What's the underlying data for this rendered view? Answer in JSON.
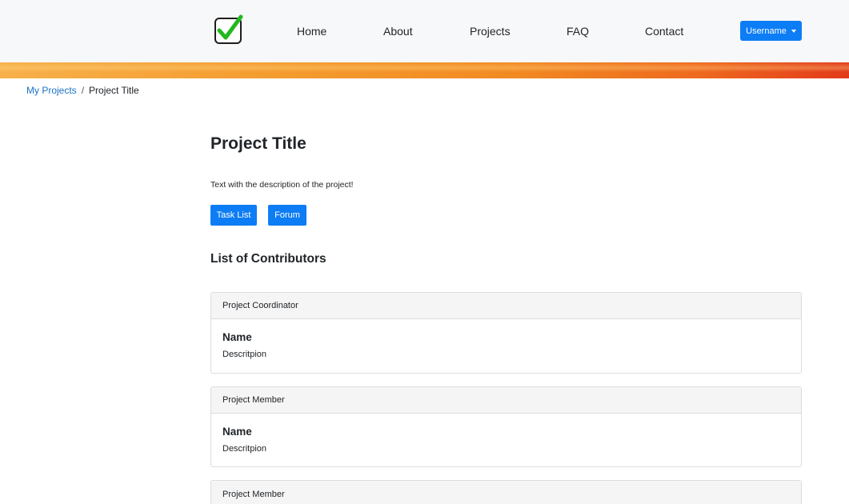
{
  "navbar": {
    "items": [
      {
        "label": "Home"
      },
      {
        "label": "About"
      },
      {
        "label": "Projects"
      },
      {
        "label": "FAQ"
      },
      {
        "label": "Contact"
      }
    ],
    "user_button": "Username",
    "accent_color": "#0d7df5"
  },
  "breadcrumb": {
    "link": "My Projects",
    "separator": "/",
    "current": "Project Title"
  },
  "project": {
    "title": "Project Title",
    "description": "Text with the description of the project!",
    "buttons": {
      "task_list": "Task List",
      "forum": "Forum"
    }
  },
  "contributors": {
    "heading": "List of Contributors",
    "cards": [
      {
        "role": "Project Coordinator",
        "name": "Name",
        "description": "Descritpion"
      },
      {
        "role": "Project Member",
        "name": "Name",
        "description": "Descritpion"
      },
      {
        "role": "Project Member"
      }
    ]
  }
}
